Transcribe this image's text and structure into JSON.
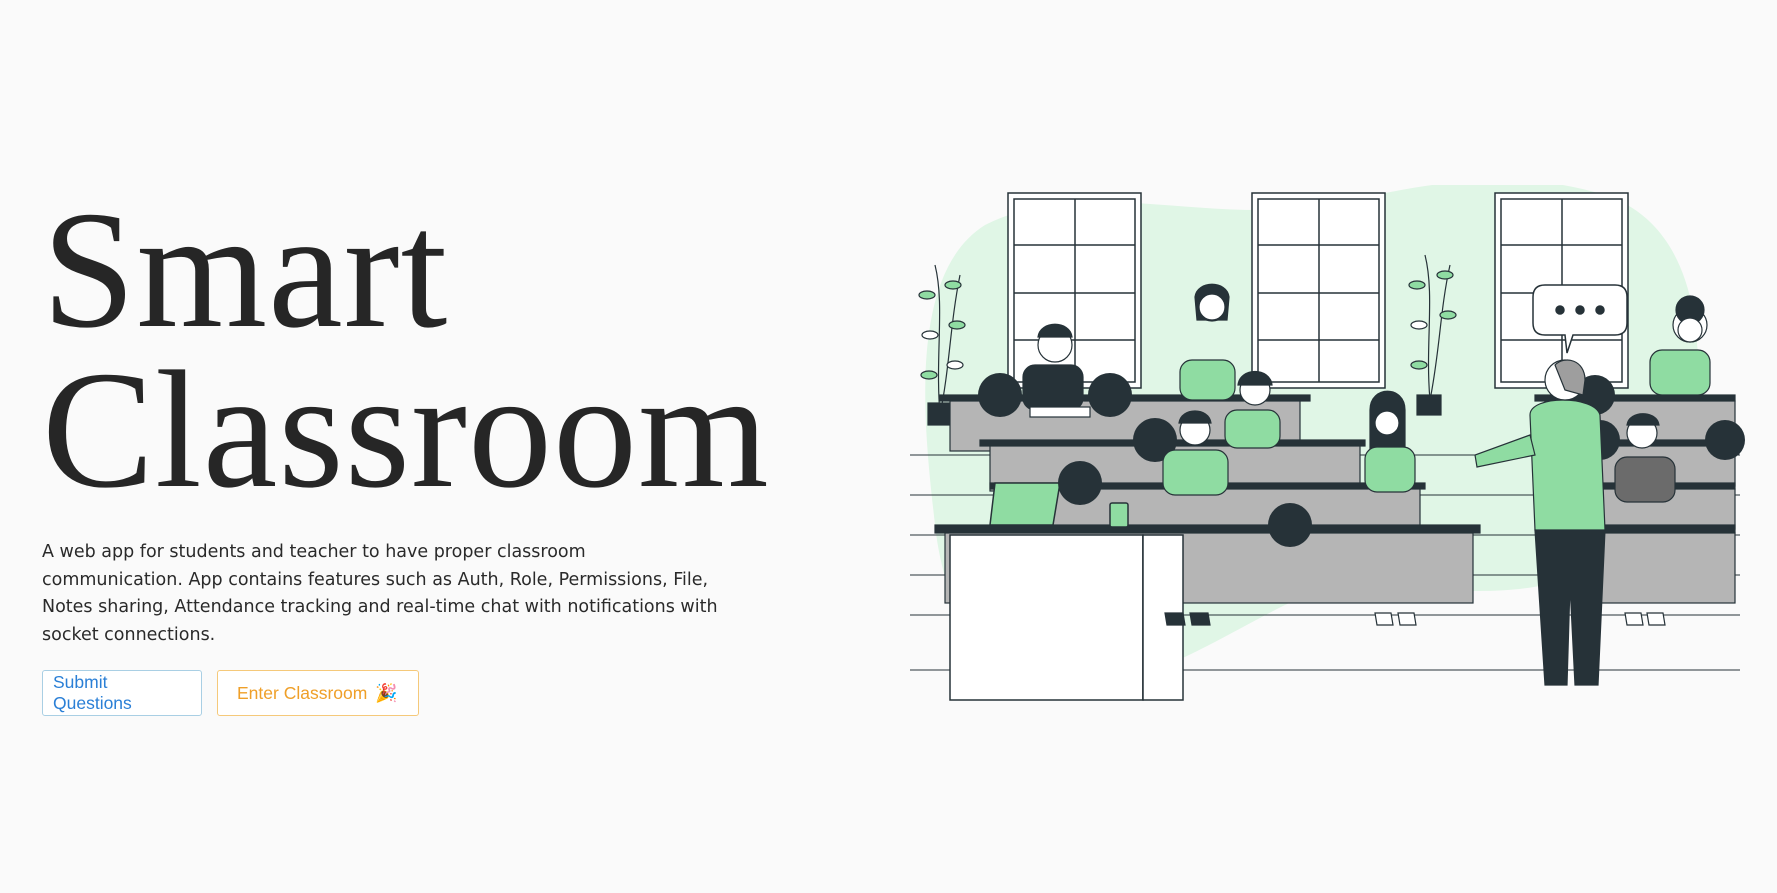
{
  "hero": {
    "title_line1": "Smart",
    "title_line2": "Classroom",
    "description": "A web app for students and teacher to have proper classroom communication. App contains features such as Auth, Role, Permissions, File, Notes sharing, Attendance tracking and real-time chat with notifications with socket connections."
  },
  "buttons": {
    "submit_label": "Submit Questions",
    "enter_label": "Enter Classroom",
    "enter_emoji": "🎉"
  },
  "colors": {
    "accent_green": "#8fdca2",
    "blob_green": "#e0f6e6",
    "dark": "#263238",
    "desk_gray": "#b5b5b5",
    "submit_blue": "#2a7fd6",
    "enter_orange": "#ef9f28"
  },
  "illustration": {
    "name": "classroom-illustration"
  }
}
